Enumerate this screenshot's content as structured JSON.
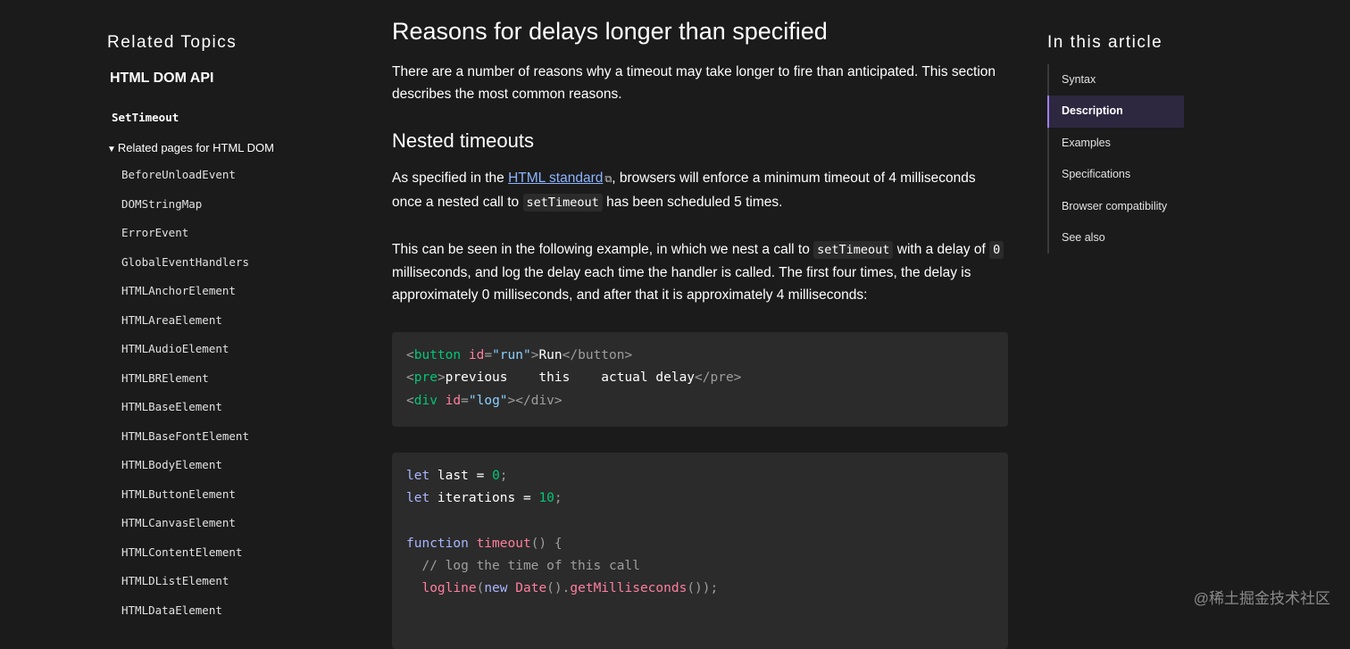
{
  "sidebar": {
    "heading": "Related Topics",
    "api": "HTML DOM API",
    "current": "SetTimeout",
    "related_label": "Related pages for HTML DOM",
    "related_triangle": "▼",
    "links": [
      "BeforeUnloadEvent",
      "DOMStringMap",
      "ErrorEvent",
      "GlobalEventHandlers",
      "HTMLAnchorElement",
      "HTMLAreaElement",
      "HTMLAudioElement",
      "HTMLBRElement",
      "HTMLBaseElement",
      "HTMLBaseFontElement",
      "HTMLBodyElement",
      "HTMLButtonElement",
      "HTMLCanvasElement",
      "HTMLContentElement",
      "HTMLDListElement",
      "HTMLDataElement"
    ]
  },
  "main": {
    "title": "Reasons for delays longer than specified",
    "p1": "There are a number of reasons why a timeout may take longer to fire than anticipated. This section describes the most common reasons.",
    "subtitle": "Nested timeouts",
    "p2_a": "As specified in the ",
    "p2_link": "HTML standard",
    "p2_b": ", browsers will enforce a minimum timeout of 4 milliseconds once a nested call to ",
    "p2_code": "setTimeout",
    "p2_c": " has been scheduled 5 times.",
    "p3_a": "This can be seen in the following example, in which we nest a call to ",
    "p3_code1": "setTimeout",
    "p3_b": " with a delay of ",
    "p3_code2": "0",
    "p3_c": " milliseconds, and log the delay each time the handler is called. The first four times, the delay is approximately 0 milliseconds, and after that it is approximately 4 milliseconds:"
  },
  "code1": {
    "l1": {
      "lt": "<",
      "tag": "button",
      "attr": "id",
      "eq": "=",
      "str": "\"run\"",
      "gt": ">",
      "text": "Run",
      "close": "</button>"
    },
    "l2": {
      "lt": "<",
      "tag": "pre",
      "gt": ">",
      "text": "previous    this    actual delay",
      "close": "</pre>"
    },
    "l3": {
      "lt": "<",
      "tag": "div",
      "attr": "id",
      "eq": "=",
      "str": "\"log\"",
      "gt": ">",
      "close": "</div>"
    }
  },
  "code2": {
    "l1": {
      "kw": "let",
      "name": " last ",
      "op": "=",
      "num": "0",
      "semi": ";"
    },
    "l2": {
      "kw": "let",
      "name": " iterations ",
      "op": "=",
      "num": "10",
      "semi": ";"
    },
    "l4": {
      "kw": "function",
      "fn": "timeout",
      "rest": "() {"
    },
    "l5": "  // log the time of this call",
    "l6": {
      "fn": "logline",
      "p1": "(",
      "kw": "new",
      "ctor": "Date",
      "p2": "().",
      "method": "getMilliseconds",
      "p3": "());"
    }
  },
  "toc": {
    "heading": "In this article",
    "items": [
      "Syntax",
      "Description",
      "Examples",
      "Specifications",
      "Browser compatibility",
      "See also"
    ],
    "active": "Description"
  },
  "watermark": "@稀土掘金技术社区",
  "colors": {
    "background": "#1b1b1b",
    "accent": "#9d7ff5",
    "link": "#8cb4ff",
    "code_bg": "#2b2b2b"
  }
}
